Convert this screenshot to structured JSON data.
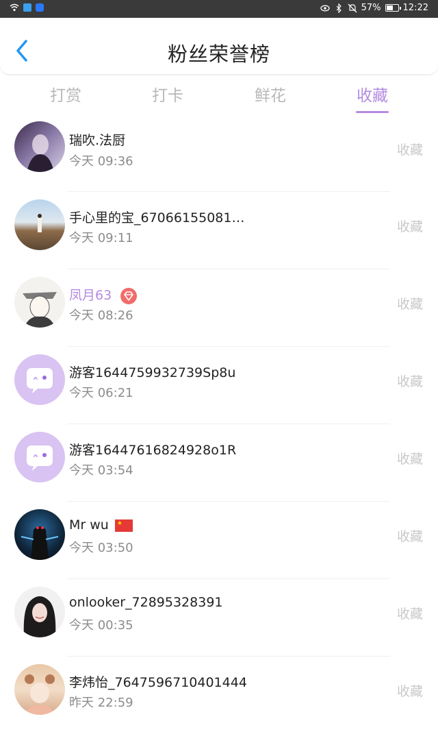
{
  "status_bar": {
    "battery": "57%",
    "time": "12:22"
  },
  "header": {
    "title": "粉丝荣誉榜"
  },
  "tabs": [
    {
      "label": "打赏",
      "active": false
    },
    {
      "label": "打卡",
      "active": false
    },
    {
      "label": "鲜花",
      "active": false
    },
    {
      "label": "收藏",
      "active": true
    }
  ],
  "rows": [
    {
      "name": "瑞吹.法厨",
      "time": "今天 09:36",
      "action": "收藏"
    },
    {
      "name": "手心里的宝_67066155081…",
      "time": "今天 09:11",
      "action": "收藏"
    },
    {
      "name": "凤月63",
      "time": "今天 08:26",
      "action": "收藏"
    },
    {
      "name": "游客1644759932739Sp8u",
      "time": "今天 06:21",
      "action": "收藏"
    },
    {
      "name": "游客16447616824928o1R",
      "time": "今天 03:54",
      "action": "收藏"
    },
    {
      "name": "Mr wu",
      "time": "今天 03:50",
      "action": "收藏"
    },
    {
      "name": "onlooker_72895328391",
      "time": "今天 00:35",
      "action": "收藏"
    },
    {
      "name": "李炜怡_7647596710401444",
      "time": "昨天 22:59",
      "action": "收藏"
    }
  ],
  "colors": {
    "accent": "#b48be0",
    "muted": "#c8c8c8",
    "back_arrow": "#2196f3"
  }
}
